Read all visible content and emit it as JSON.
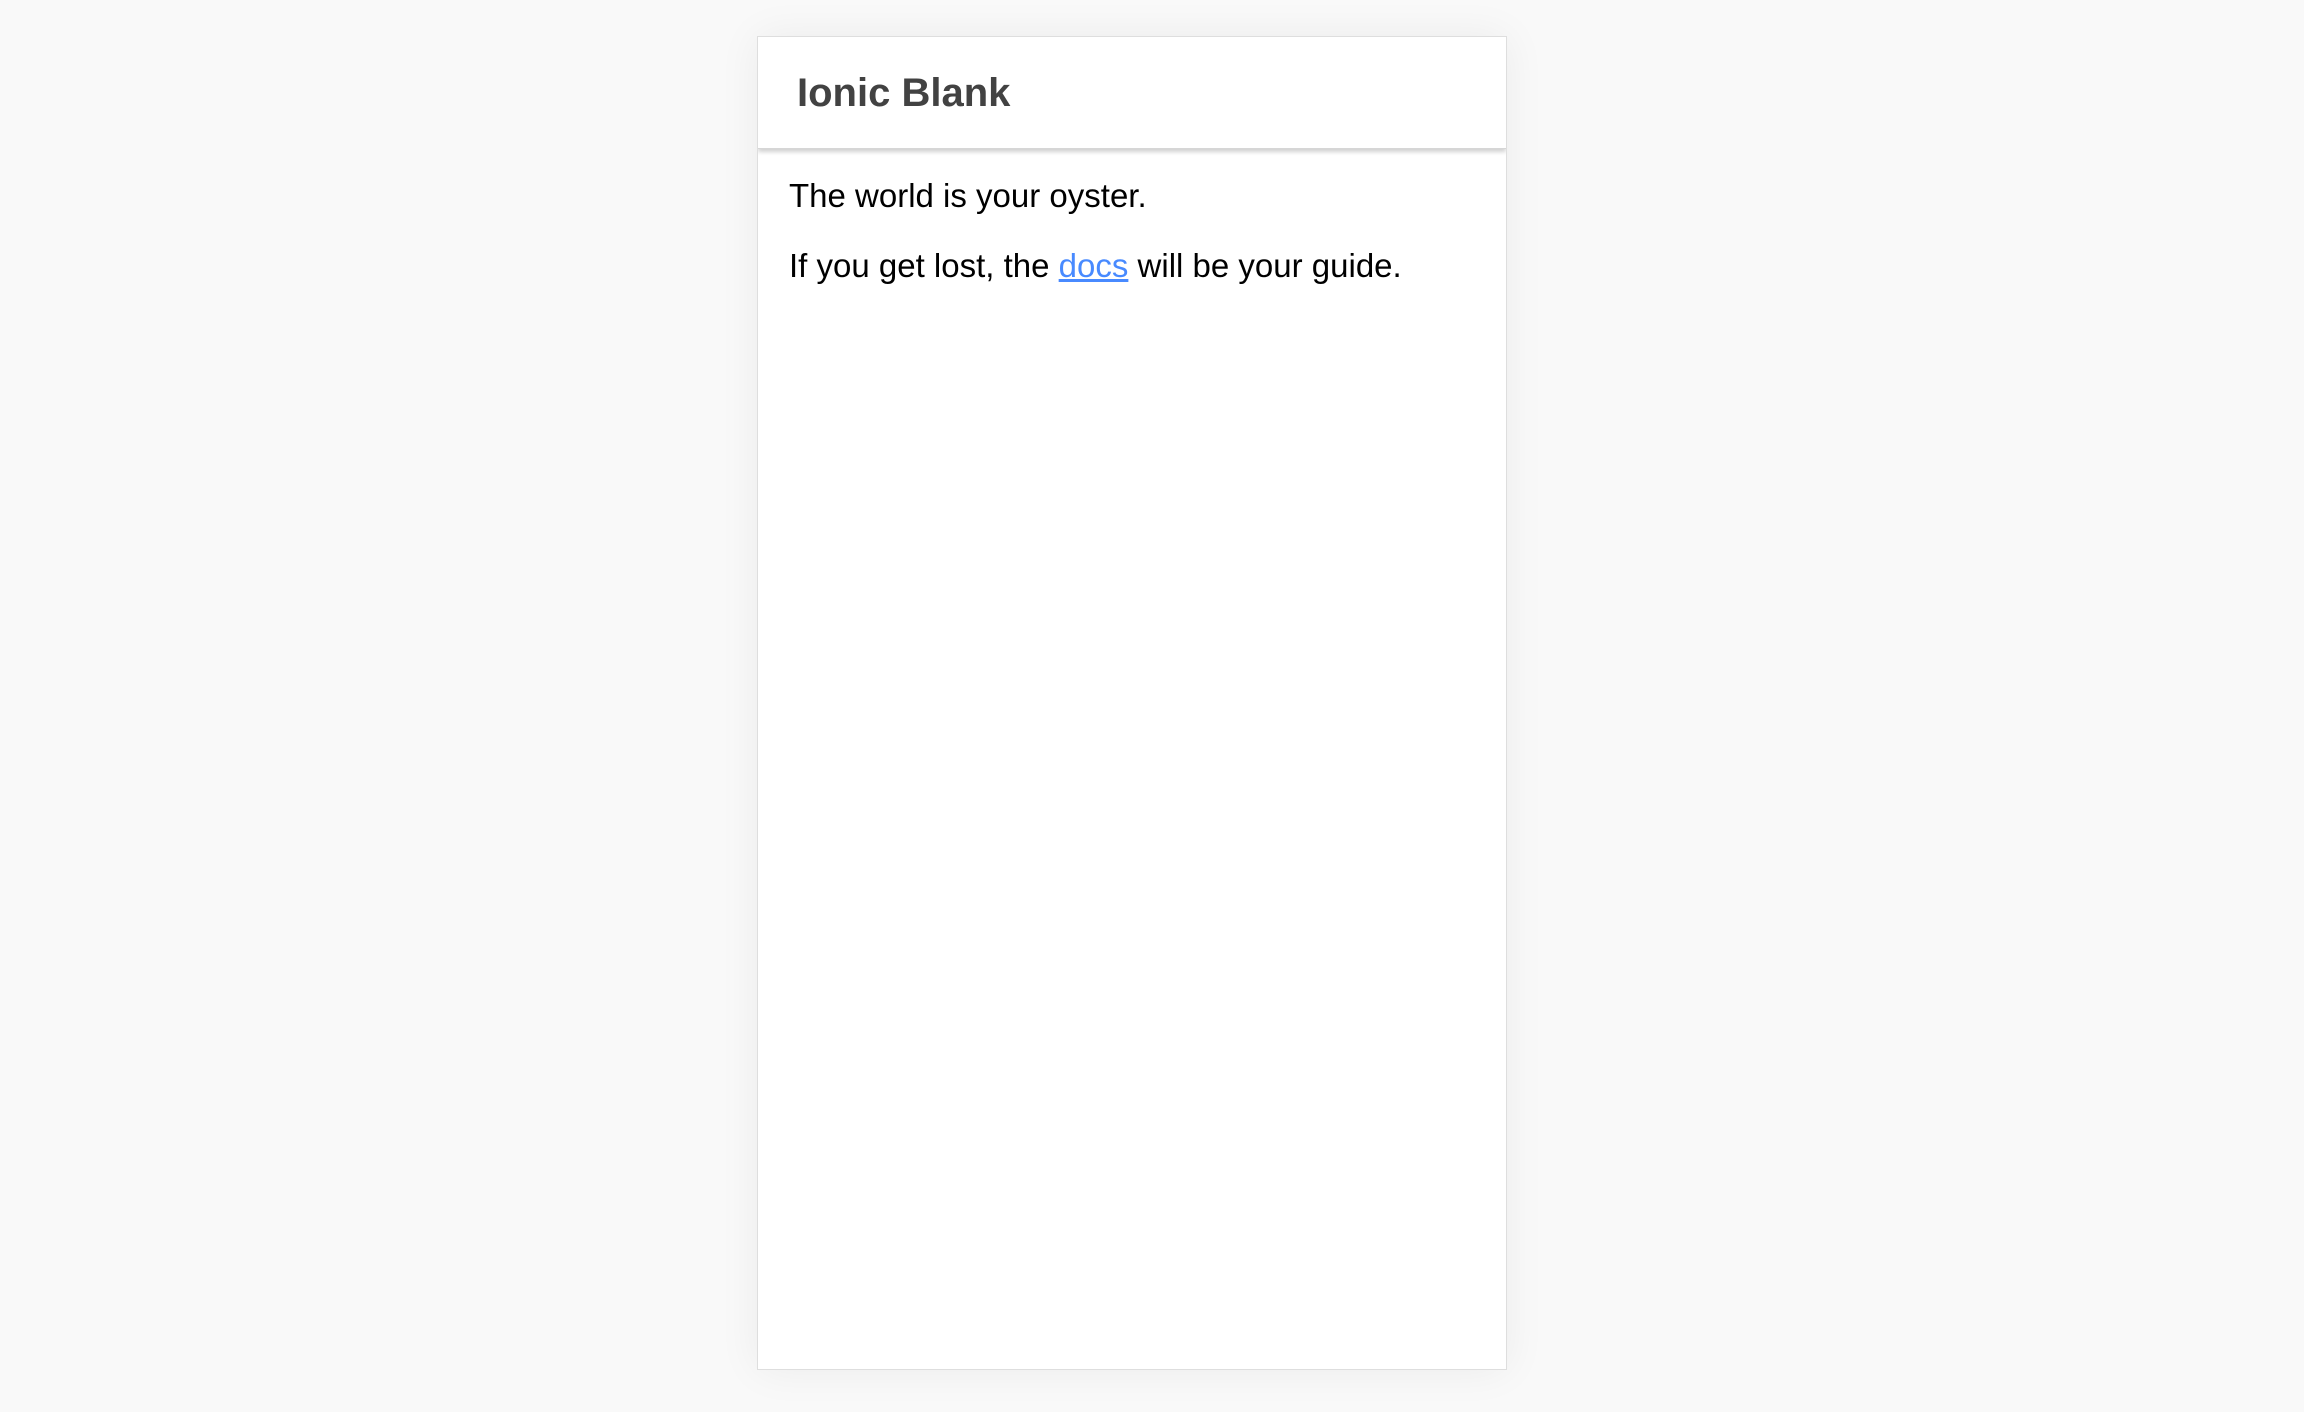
{
  "toolbar": {
    "title": "Ionic Blank"
  },
  "content": {
    "line1": "The world is your oyster.",
    "line2_before": "If you get lost, the ",
    "line2_link": "docs",
    "line2_after": " will be your guide."
  },
  "colors": {
    "page_background": "#f9f9f9",
    "toolbar_title": "#424242",
    "link": "#488aff",
    "text": "#000000"
  }
}
